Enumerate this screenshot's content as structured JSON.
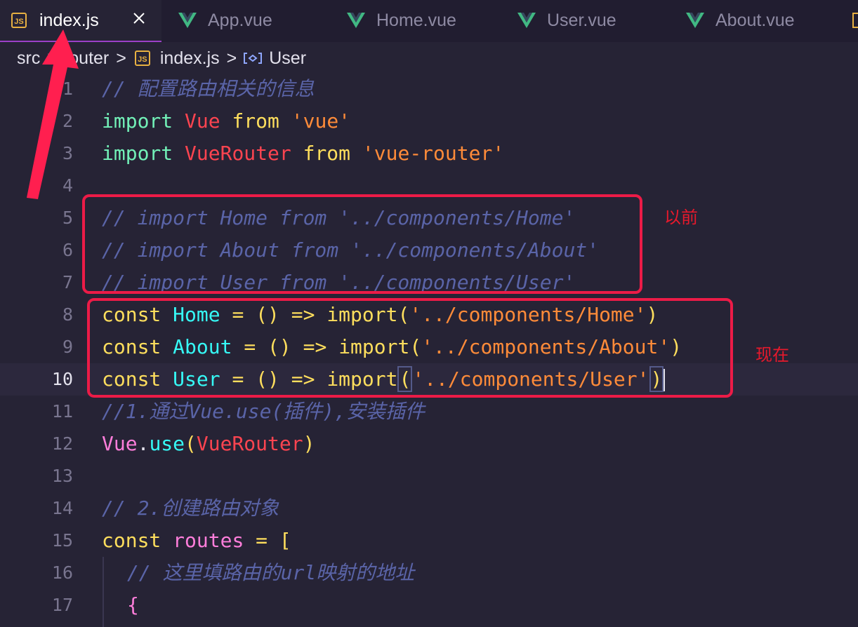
{
  "tabs": [
    {
      "label": "index.js",
      "icon": "js-icon",
      "active": true
    },
    {
      "label": "App.vue",
      "icon": "vue-icon"
    },
    {
      "label": "Home.vue",
      "icon": "vue-icon"
    },
    {
      "label": "User.vue",
      "icon": "vue-icon"
    },
    {
      "label": "About.vue",
      "icon": "vue-icon"
    }
  ],
  "breadcrumb": {
    "root": "src",
    "router": "router",
    "file": "index.js",
    "symbol": "User",
    "separator": ">"
  },
  "line_numbers": [
    "1",
    "2",
    "3",
    "4",
    "5",
    "6",
    "7",
    "8",
    "9",
    "10",
    "11",
    "12",
    "13",
    "14",
    "15",
    "16",
    "17"
  ],
  "code": {
    "l1": "// 配置路由相关的信息",
    "l2": {
      "kw1": "import",
      "id": "Vue",
      "kw2": "from",
      "str": "'vue'"
    },
    "l3": {
      "kw1": "import",
      "id": "VueRouter",
      "kw2": "from",
      "str": "'vue-router'"
    },
    "l5": "// import Home from '../components/Home'",
    "l6": "// import About from '../components/About'",
    "l7": "// import User from '../components/User'",
    "l8": {
      "kw": "const",
      "id": "Home",
      "eq": "=",
      "arrow": "() =>",
      "fn": "import",
      "open": "(",
      "str": "'../components/Home'",
      "close": ")"
    },
    "l9": {
      "kw": "const",
      "id": "About",
      "eq": "=",
      "arrow": "() =>",
      "fn": "import",
      "open": "(",
      "str": "'../components/About'",
      "close": ")"
    },
    "l10": {
      "kw": "const",
      "id": "User",
      "eq": "=",
      "arrow": "() =>",
      "fn": "import",
      "open": "(",
      "str": "'../components/User'",
      "close": ")"
    },
    "l11": "//1.通过Vue.use(插件),安装插件",
    "l12": {
      "obj": "Vue",
      "dot": ".",
      "fn": "use",
      "open": "(",
      "arg": "VueRouter",
      "close": ")"
    },
    "l14": "// 2.创建路由对象",
    "l15": {
      "kw": "const",
      "id": "routes",
      "eq": "=",
      "open": "["
    },
    "l16": "// 这里填路由的url映射的地址",
    "l17": "{"
  },
  "annotations": {
    "before": "以前",
    "now": "现在"
  },
  "colors": {
    "background": "#262335",
    "comment": "#5a64a8",
    "keyword": "#fede5d",
    "string": "#ff8b39",
    "annotation": "#ec1b47"
  }
}
